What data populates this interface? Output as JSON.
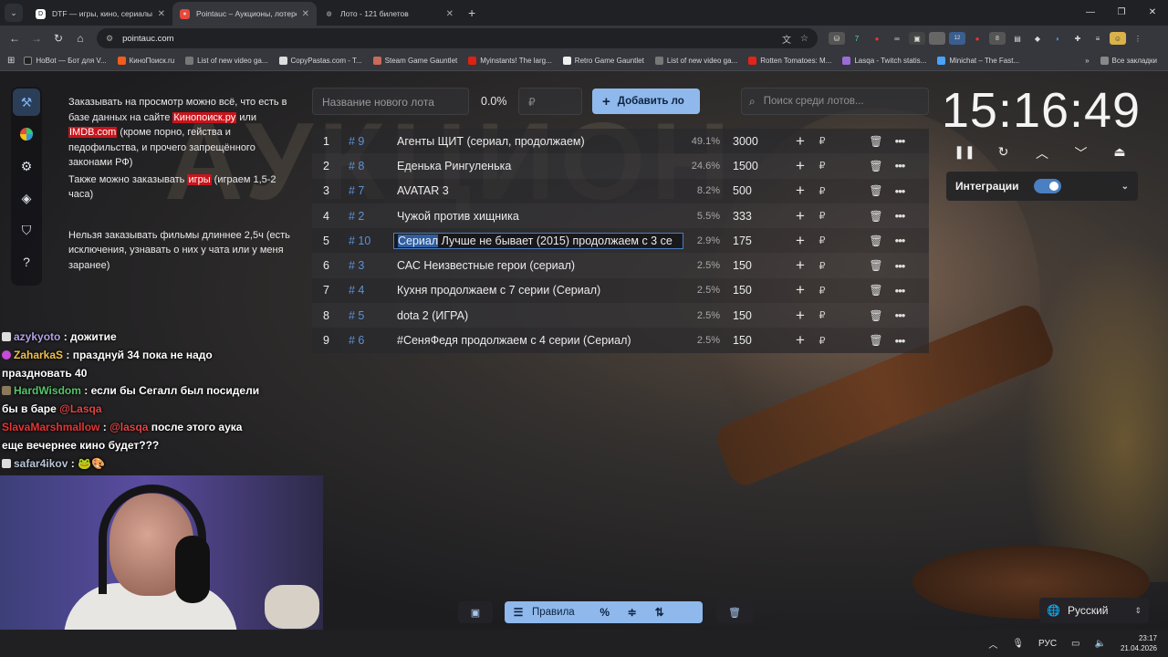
{
  "browser": {
    "tabs": [
      {
        "title": "DTF — игры, кино, сериалы, р",
        "active": false,
        "favicon": "dtf-icon"
      },
      {
        "title": "Pointauc – Аукционы, лотереи",
        "active": true,
        "favicon": "pointauc-icon"
      },
      {
        "title": "Лото - 121 билетов",
        "active": false,
        "favicon": "globe-icon"
      }
    ],
    "url": "pointauc.com",
    "bookmarks": [
      "HoBot — Бот для V...",
      "КиноПоиск.ru",
      "List of new video ga...",
      "CopyPastas.com - T...",
      "Steam Game Gauntlet",
      "Myinstants! The larg...",
      "Retro Game Gauntlet",
      "List of new video ga...",
      "Rotten Tomatoes: M...",
      "Lasqa - Twitch statis...",
      "Minichat – The Fast..."
    ],
    "bookmarks_more": "»",
    "all_bookmarks": "Все закладки",
    "ext_badge_1": "12",
    "ext_badge_2": "8"
  },
  "rules_text": {
    "p1_a": "Заказывать на просмотр можно всё, что есть в базе данных на сайте ",
    "p1_link1": "Кинопоиск.ру",
    "p1_b": " или ",
    "p1_link2": "IMDB.com",
    "p1_c": " (кроме порно, гейства и педофильства, и прочего запрещённого законами РФ)",
    "p2_a": "Также можно заказывать ",
    "p2_link": "игры",
    "p2_b": " (играем 1,5-2 часа)",
    "p3": "Нельзя заказывать фильмы длиннее 2,5ч (есть исключения, узнавать о них у чата или у меня заранее)"
  },
  "controls": {
    "new_lot_placeholder": "Название нового лота",
    "percent": "0.0%",
    "amount_placeholder": "₽",
    "add_button": "Добавить ло",
    "search_placeholder": "Поиск среди лотов..."
  },
  "lots": [
    {
      "n": "1",
      "id": "# 9",
      "name": "Агенты ЩИТ (сериал, продолжаем)",
      "pct": "49.1%",
      "amount": "3000"
    },
    {
      "n": "2",
      "id": "# 8",
      "name": "Еденька Рингуленька",
      "pct": "24.6%",
      "amount": "1500"
    },
    {
      "n": "3",
      "id": "# 7",
      "name": "AVATAR 3",
      "pct": "8.2%",
      "amount": "500"
    },
    {
      "n": "4",
      "id": "# 2",
      "name": "Чужой против хищника",
      "pct": "5.5%",
      "amount": "333"
    },
    {
      "n": "5",
      "id": "# 10",
      "name_sel": "Сериал",
      "name": " Лучше не бывает (2015) продолжаем с 3 се",
      "pct": "2.9%",
      "amount": "175"
    },
    {
      "n": "6",
      "id": "# 3",
      "name": "САС Неизвестные герои (сериал)",
      "pct": "2.5%",
      "amount": "150"
    },
    {
      "n": "7",
      "id": "# 4",
      "name": "Кухня продолжаем с 7 серии (Сериал)",
      "pct": "2.5%",
      "amount": "150"
    },
    {
      "n": "8",
      "id": "# 5",
      "name": "dota 2 (ИГРА)",
      "pct": "2.5%",
      "amount": "150"
    },
    {
      "n": "9",
      "id": "# 6",
      "name": " #СеняФедя продолжаем с 4 серии (Сериал)",
      "pct": "2.5%",
      "amount": "150"
    }
  ],
  "lot_currency": "₽",
  "timer": {
    "time": "15:16:49"
  },
  "integrations": {
    "label": "Интеграции",
    "enabled": true
  },
  "chat": [
    {
      "user": "azykyoto",
      "msg": " дожитие",
      "color": "#b2a0e6"
    },
    {
      "user": "ZaharkaS",
      "msg": " празднуй 34 пока не надо праздновать 40",
      "color": "#f0c04a"
    },
    {
      "user": "HardWisdom",
      "msg": " если бы Сегалл был посидели бы в баре ",
      "mention": "@Lasqa",
      "color": "#55c46b"
    },
    {
      "user": "SlavaMarshmallow",
      "mention": "@lasqa",
      "msg": " после этого аука еще вечернее кино будет???",
      "color": "#e63535"
    },
    {
      "user": "safar4ikov",
      "msg": " ",
      "color": "#b9c6d6"
    }
  ],
  "chat_sep": " :",
  "bottom": {
    "rules_label": "Правила",
    "percent_icon": "%",
    "language": "Русский"
  },
  "taskbar": {
    "lang": "РУС",
    "time": "23:17",
    "date": "21.04.2026"
  }
}
